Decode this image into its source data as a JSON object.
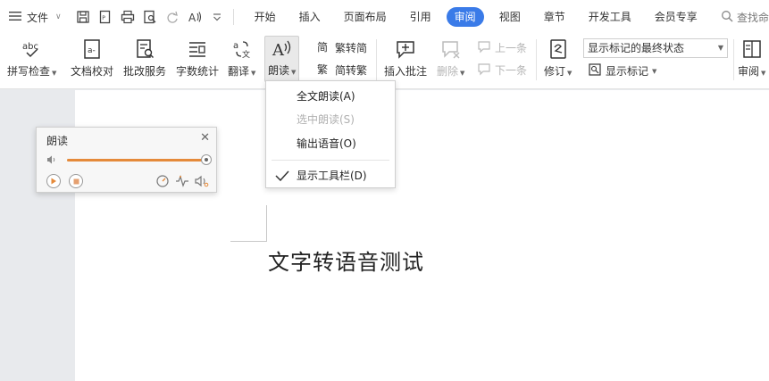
{
  "menubar": {
    "file_label": "文件",
    "tabs": [
      "开始",
      "插入",
      "页面布局",
      "引用",
      "审阅",
      "视图",
      "章节",
      "开发工具",
      "会员专享"
    ],
    "active_tab": "审阅",
    "search_label": "查找命"
  },
  "ribbon": {
    "spellcheck": "拼写检查",
    "doc_proof": "文档校对",
    "correction_service": "批改服务",
    "word_count": "字数统计",
    "translate": "翻译",
    "read_aloud": "朗读",
    "trad_to_simp": "繁转简",
    "simp_to_trad": "简转繁",
    "insert_comment": "插入批注",
    "delete": "删除",
    "prev": "上一条",
    "next": "下一条",
    "revise": "修订",
    "markup_select_value": "显示标记的最终状态",
    "show_markup": "显示标记",
    "review": "审阅"
  },
  "read_menu": {
    "items": [
      {
        "label": "全文朗读(A)",
        "enabled": true,
        "checked": false
      },
      {
        "label": "选中朗读(S)",
        "enabled": false,
        "checked": false
      },
      {
        "label": "输出语音(O)",
        "enabled": true,
        "checked": false
      },
      {
        "label": "显示工具栏(D)",
        "enabled": true,
        "checked": true
      }
    ]
  },
  "read_panel": {
    "title": "朗读",
    "volume_fraction": 1.0
  },
  "document": {
    "text": "文字转语音测试"
  },
  "colors": {
    "accent": "#3a7be8",
    "slider_fill": "#e58a3a"
  }
}
